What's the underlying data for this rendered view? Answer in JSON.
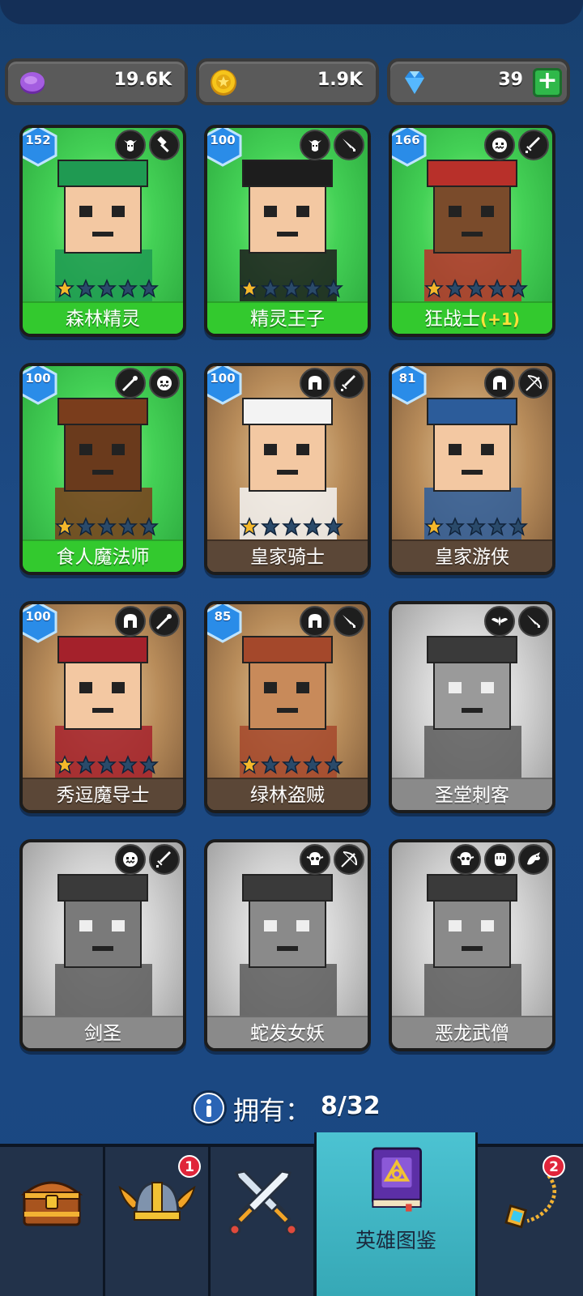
{
  "currency": [
    {
      "type": "purple-gem",
      "value": "19.6K"
    },
    {
      "type": "gold-coin",
      "value": "1.9K"
    },
    {
      "type": "blue-diamond",
      "value": "39"
    }
  ],
  "heroes": [
    {
      "name": "森林精灵",
      "level": "152",
      "rarity": "green",
      "stars": 1,
      "class_icons": [
        "elf-face-icon",
        "hammer-icon"
      ]
    },
    {
      "name": "精灵王子",
      "level": "100",
      "rarity": "green",
      "stars": 1,
      "class_icons": [
        "elf-face-icon",
        "dagger-icon"
      ]
    },
    {
      "name": "狂战士",
      "name_bonus": "(+1)",
      "level": "166",
      "rarity": "green",
      "stars": 1,
      "class_icons": [
        "orc-face-icon",
        "sword-icon"
      ]
    },
    {
      "name": "食人魔法师",
      "level": "100",
      "rarity": "green",
      "stars": 1,
      "class_icons": [
        "wand-icon",
        "orc-face-icon"
      ]
    },
    {
      "name": "皇家骑士",
      "level": "100",
      "rarity": "tan",
      "stars": 1,
      "class_icons": [
        "helmet-icon",
        "sword-icon"
      ]
    },
    {
      "name": "皇家游侠",
      "level": "81",
      "rarity": "tan",
      "stars": 1,
      "class_icons": [
        "helmet-icon",
        "bow-icon"
      ]
    },
    {
      "name": "秀逗魔导士",
      "level": "100",
      "rarity": "tan",
      "stars": 1,
      "class_icons": [
        "helmet-icon",
        "wand-icon"
      ]
    },
    {
      "name": "绿林盗贼",
      "level": "85",
      "rarity": "tan",
      "stars": 1,
      "class_icons": [
        "helmet-icon",
        "dagger-icon"
      ]
    },
    {
      "name": "圣堂刺客",
      "level": "",
      "rarity": "gray",
      "stars": 0,
      "class_icons": [
        "winged-emblem-icon",
        "dagger-icon"
      ]
    },
    {
      "name": "剑圣",
      "level": "",
      "rarity": "gray",
      "stars": 0,
      "class_icons": [
        "orc-face-icon",
        "sword-icon"
      ]
    },
    {
      "name": "蛇发女妖",
      "level": "",
      "rarity": "gray",
      "stars": 0,
      "class_icons": [
        "skull-icon",
        "bow-icon"
      ]
    },
    {
      "name": "恶龙武僧",
      "level": "",
      "rarity": "gray",
      "stars": 0,
      "class_icons": [
        "skull-icon",
        "fist-icon",
        "dragon-icon"
      ]
    }
  ],
  "owned": {
    "label": "拥有：",
    "count": "8/32"
  },
  "nav": {
    "tabs": [
      {
        "icon": "treasure-chest-icon",
        "label": ""
      },
      {
        "icon": "viking-helmet-icon",
        "label": "",
        "badge": "1"
      },
      {
        "icon": "crossed-swords-icon",
        "label": ""
      },
      {
        "icon": "hero-book-icon",
        "label": "英雄图鉴",
        "active": true
      },
      {
        "icon": "amulet-icon",
        "label": "",
        "badge": "2"
      }
    ]
  },
  "colors": {
    "background": "#1d4a84",
    "card_green": "#33c92e",
    "card_tan": "#5b4737",
    "card_gray": "#8a8a8a",
    "nav_active": "#4cc3d2",
    "notification": "#e0253a"
  }
}
